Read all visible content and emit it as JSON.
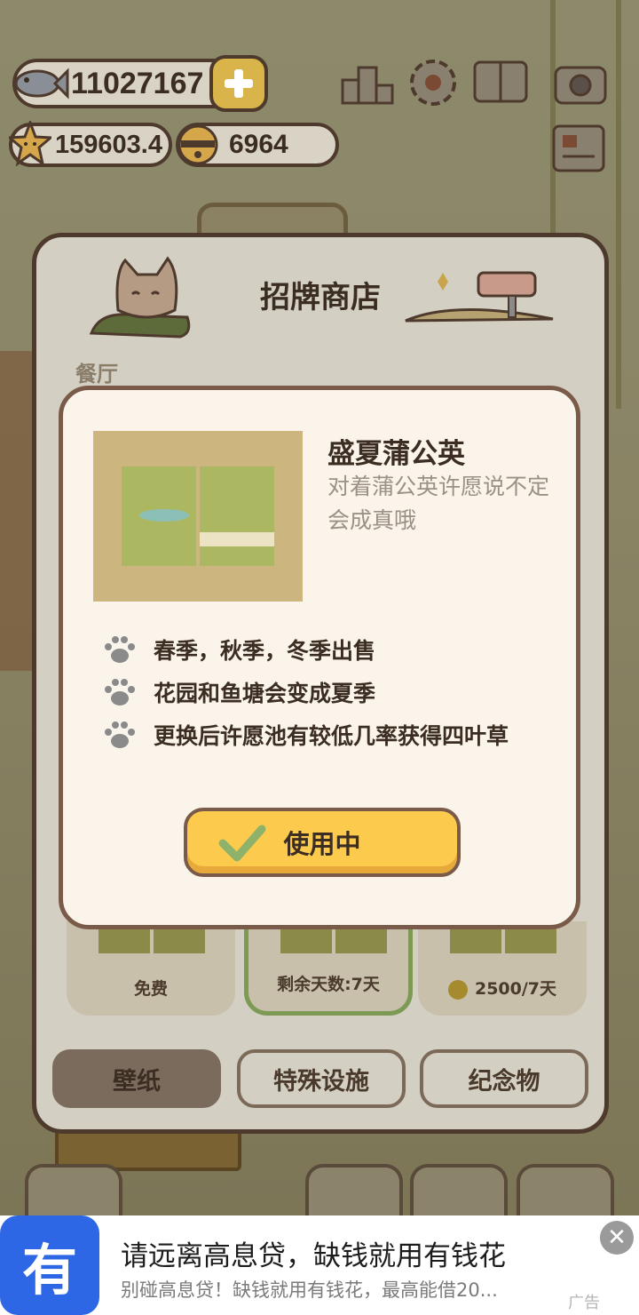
{
  "hud": {
    "fish": "11027167",
    "stars": "159603.4",
    "bells": "6964"
  },
  "shop": {
    "title": "招牌商店",
    "section": "餐厅",
    "cards": [
      {
        "label": "免费"
      },
      {
        "label": "剩余天数:7天"
      },
      {
        "label": "2500/7天"
      }
    ],
    "tabs": [
      "壁纸",
      "特殊设施",
      "纪念物"
    ]
  },
  "detail": {
    "name": "盛夏蒲公英",
    "description": "对着蒲公英许愿说不定会成真哦",
    "features": [
      "春季，秋季，冬季出售",
      "花园和鱼塘会变成夏季",
      "更换后许愿池有较低几率获得四叶草"
    ],
    "button": "使用中"
  },
  "ad": {
    "logo_char": "有",
    "title": "请远离高息贷，缺钱就用有钱花",
    "subtitle": "别碰高息贷！缺钱就用有钱花，最高能借20...",
    "mark": "广告"
  },
  "colors": {
    "primary_button": "#fccb4e",
    "dialog_bg": "#fbf4ea",
    "ad_blue": "#2d67e6"
  },
  "icons": [
    "fish-icon",
    "plus-icon",
    "star-icon",
    "bell-icon",
    "ranking-icon",
    "gear-icon",
    "album-icon",
    "camera-icon",
    "news-icon",
    "paw-icon",
    "check-icon",
    "close-icon"
  ]
}
